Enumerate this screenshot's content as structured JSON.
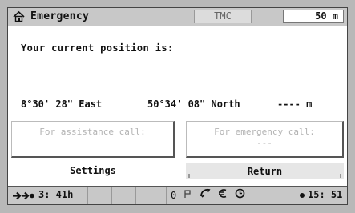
{
  "titlebar": {
    "title": "Emergency",
    "tmc": "TMC",
    "distance": "50 m",
    "icon": "home-icon"
  },
  "main": {
    "prompt": "Your current position is:",
    "longitude": "8°30' 28\" East",
    "latitude": "50°34' 08\" North",
    "altitude": "---- m"
  },
  "buttons": {
    "assistance_call": "For assistance call:",
    "emergency_call": "For emergency call:",
    "emergency_call_value": "---",
    "settings": "Settings",
    "return": "Return"
  },
  "statusbar": {
    "eta": "3: 41h",
    "signal_text": "0",
    "clock": "15: 51",
    "icons": [
      "direction-arrow-icon",
      "antenna-icon",
      "phone-icon",
      "euro-icon",
      "clock-icon"
    ]
  }
}
